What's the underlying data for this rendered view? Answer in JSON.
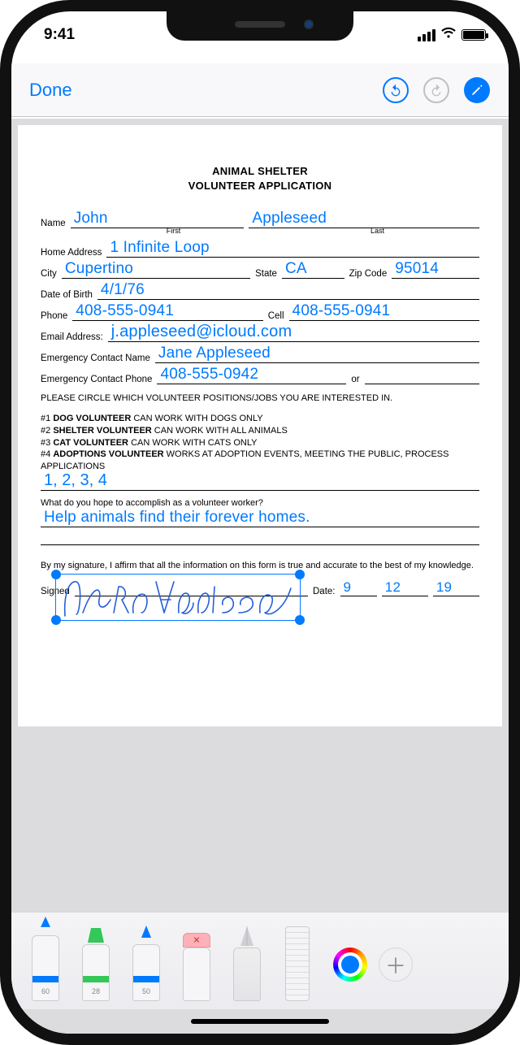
{
  "statusbar": {
    "time": "9:41"
  },
  "toolbar": {
    "done": "Done"
  },
  "doc": {
    "title1": "ANIMAL SHELTER",
    "title2": "VOLUNTEER APPLICATION",
    "labels": {
      "name": "Name",
      "first": "First",
      "last": "Last",
      "home_address": "Home Address",
      "city": "City",
      "state": "State",
      "zip": "Zip Code",
      "dob": "Date of Birth",
      "phone": "Phone",
      "cell": "Cell",
      "email": "Email Address:",
      "ec_name": "Emergency Contact Name",
      "ec_phone": "Emergency Contact Phone",
      "or": "or",
      "signed": "Signed",
      "date": "Date:"
    },
    "values": {
      "first_name": "John",
      "last_name": "Appleseed",
      "home_address": "1 Infinite Loop",
      "city": "Cupertino",
      "state": "CA",
      "zip": "95014",
      "dob": "4/1/76",
      "phone": "408-555-0941",
      "cell": "408-555-0941",
      "email": "j.appleseed@icloud.com",
      "ec_name": "Jane Appleseed",
      "ec_phone": "408-555-0942",
      "choices": "1, 2, 3, 4",
      "hope": "Help animals find their forever homes.",
      "sign_date_m": "9",
      "sign_date_d": "12",
      "sign_date_y": "19"
    },
    "positions_intro": "PLEASE CIRCLE WHICH VOLUNTEER POSITIONS/JOBS YOU ARE INTERESTED IN.",
    "positions": [
      {
        "n": "#1",
        "name": "DOG VOLUNTEER",
        "desc": "CAN WORK WITH DOGS ONLY"
      },
      {
        "n": "#2",
        "name": "SHELTER VOLUNTEER",
        "desc": "CAN WORK WITH ALL ANIMALS"
      },
      {
        "n": "#3",
        "name": "CAT VOLUNTEER",
        "desc": "CAN WORK WITH CATS ONLY"
      },
      {
        "n": "#4",
        "name": "ADOPTIONS VOLUNTEER",
        "desc": "WORKS AT ADOPTION EVENTS, MEETING THE PUBLIC, PROCESS APPLICATIONS"
      }
    ],
    "hope_q": "What do you hope to accomplish as a volunteer worker?",
    "affirm": "By my signature, I affirm that all the information on this form is true and accurate to the best of my knowledge."
  },
  "palette": {
    "sizes": {
      "pen": "60",
      "marker": "28",
      "pencil": "50"
    }
  }
}
